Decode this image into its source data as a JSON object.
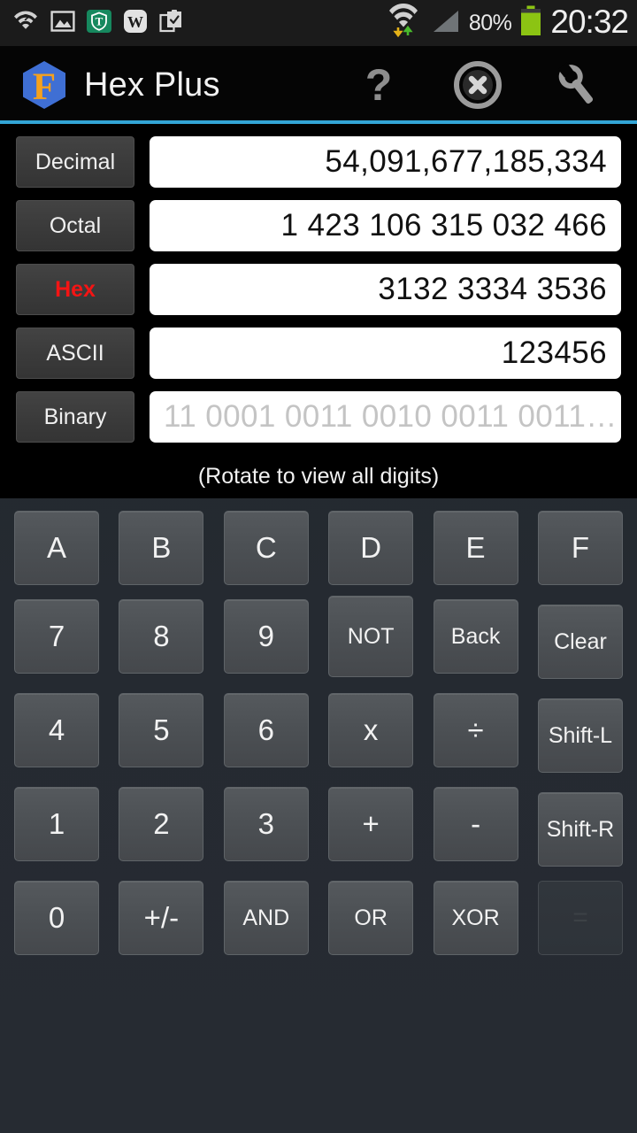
{
  "status_bar": {
    "battery_percent": "80%",
    "clock": "20:32",
    "left_icons": [
      {
        "name": "wifi-question-icon"
      },
      {
        "name": "gallery-image-icon"
      },
      {
        "name": "shield-t-icon"
      },
      {
        "name": "wikipedia-w-icon"
      },
      {
        "name": "clipboard-check-icon"
      }
    ],
    "right_icons": [
      {
        "name": "wifi-data-transfer-icon"
      },
      {
        "name": "cellular-signal-icon"
      },
      {
        "name": "battery-icon"
      }
    ]
  },
  "app_bar": {
    "title": "Hex Plus",
    "logo_letter": "F",
    "actions": [
      {
        "name": "help-icon",
        "glyph": "?"
      },
      {
        "name": "close-circle-icon"
      },
      {
        "name": "wrench-settings-icon"
      }
    ]
  },
  "display": {
    "rows": [
      {
        "label": "Decimal",
        "value": "54,091,677,185,334",
        "active": false,
        "muted": false
      },
      {
        "label": "Octal",
        "value": "1 423 106 315 032 466",
        "active": false,
        "muted": false
      },
      {
        "label": "Hex",
        "value": "3132 3334 3536",
        "active": true,
        "muted": false
      },
      {
        "label": "ASCII",
        "value": "123456",
        "active": false,
        "muted": false
      },
      {
        "label": "Binary",
        "value": "11 0001 0011 0010 0011 0011…",
        "active": false,
        "muted": true
      }
    ],
    "rotate_note": "(Rotate to view all digits)"
  },
  "keypad": {
    "rows": [
      [
        {
          "label": "A",
          "size": "big",
          "variant": "normal"
        },
        {
          "label": "B",
          "size": "big",
          "variant": "normal"
        },
        {
          "label": "C",
          "size": "big",
          "variant": "normal"
        },
        {
          "label": "D",
          "size": "big",
          "variant": "normal"
        },
        {
          "label": "E",
          "size": "big",
          "variant": "normal"
        },
        {
          "label": "F",
          "size": "big",
          "variant": "normal"
        }
      ],
      [
        {
          "label": "7",
          "size": "big",
          "variant": "normal"
        },
        {
          "label": "8",
          "size": "big",
          "variant": "normal"
        },
        {
          "label": "9",
          "size": "big",
          "variant": "normal"
        },
        {
          "label": "NOT",
          "size": "small",
          "variant": "tall"
        },
        {
          "label": "Back",
          "size": "small",
          "variant": "normal"
        },
        {
          "label": "Clear",
          "size": "small",
          "variant": "shifted"
        }
      ],
      [
        {
          "label": "4",
          "size": "big",
          "variant": "normal"
        },
        {
          "label": "5",
          "size": "big",
          "variant": "normal"
        },
        {
          "label": "6",
          "size": "big",
          "variant": "normal"
        },
        {
          "label": "x",
          "size": "big",
          "variant": "normal"
        },
        {
          "label": "÷",
          "size": "big",
          "variant": "normal"
        },
        {
          "label": "Shift-L",
          "size": "small",
          "variant": "shifted"
        }
      ],
      [
        {
          "label": "1",
          "size": "big",
          "variant": "normal"
        },
        {
          "label": "2",
          "size": "big",
          "variant": "normal"
        },
        {
          "label": "3",
          "size": "big",
          "variant": "normal"
        },
        {
          "label": "+",
          "size": "big",
          "variant": "normal"
        },
        {
          "label": "-",
          "size": "big",
          "variant": "normal"
        },
        {
          "label": "Shift-R",
          "size": "small",
          "variant": "shifted"
        }
      ],
      [
        {
          "label": "0",
          "size": "big",
          "variant": "normal"
        },
        {
          "label": "+/-",
          "size": "big",
          "variant": "normal"
        },
        {
          "label": "AND",
          "size": "small",
          "variant": "normal"
        },
        {
          "label": "OR",
          "size": "small",
          "variant": "normal"
        },
        {
          "label": "XOR",
          "size": "small",
          "variant": "normal"
        },
        {
          "label": "=",
          "size": "big",
          "variant": "disabled"
        }
      ]
    ]
  },
  "colors": {
    "accent_bar": "#33a5d6",
    "active_label": "#f41414",
    "battery_green": "#8cc413",
    "logo_blue": "#3f6fd4",
    "logo_orange": "#f5a11d",
    "shield_green": "#16885e"
  }
}
